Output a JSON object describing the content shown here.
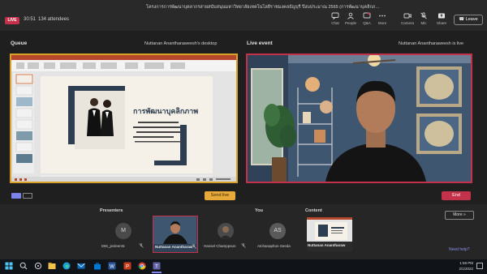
{
  "topbar": {
    "live_badge": "LIVE",
    "timer": "30:51",
    "attendees": "134 attendees",
    "meeting_title": "โครงการการพัฒนาบุคลากรสายสนับสนุนมหาวิทยาลัยเทคโนโลยีราชมงคลธัญบุรี ปีงบประมาณ 2565 (การพัฒนาบุคลิกภาพ)",
    "buttons": [
      {
        "label": "Chat",
        "icon": "chat-icon"
      },
      {
        "label": "People",
        "icon": "people-icon"
      },
      {
        "label": "Q&A",
        "icon": "qa-icon"
      },
      {
        "label": "More",
        "icon": "more-icon"
      },
      {
        "label": "Camera",
        "icon": "camera-icon"
      },
      {
        "label": "Mic",
        "icon": "mic-icon"
      },
      {
        "label": "Share",
        "icon": "share-icon"
      }
    ],
    "leave_label": "Leave"
  },
  "queue": {
    "label": "Queue",
    "owner": "Nuttanan Anantharaweesh's desktop",
    "slide_title": "การพัฒนาบุคลิกภาพ",
    "send_live_label": "Send live"
  },
  "live": {
    "label": "Live event",
    "owner": "Nuttanan Anantharaweesh is live",
    "end_label": "End"
  },
  "presenters": {
    "label": "Presenters",
    "people": [
      {
        "initial": "M",
        "name": "MIS_jevleem5"
      },
      {
        "initial": "",
        "name": "Nuttanan Anantharaw"
      },
      {
        "initial": "",
        "name": "Hansel Champpson"
      }
    ]
  },
  "you": {
    "label": "You",
    "initials": "AS",
    "name": "Atchanaphon Seeda"
  },
  "content": {
    "label": "Content",
    "name": "Nuttanan Anantharaw"
  },
  "more_label": "More »",
  "need_help": "Need help?",
  "system_tray": {
    "time": "1:59 PM",
    "date": "2/1/2022"
  },
  "colors": {
    "accent": "#7b83eb",
    "live_red": "#c4314b",
    "queue_gold": "#d8a22a"
  }
}
